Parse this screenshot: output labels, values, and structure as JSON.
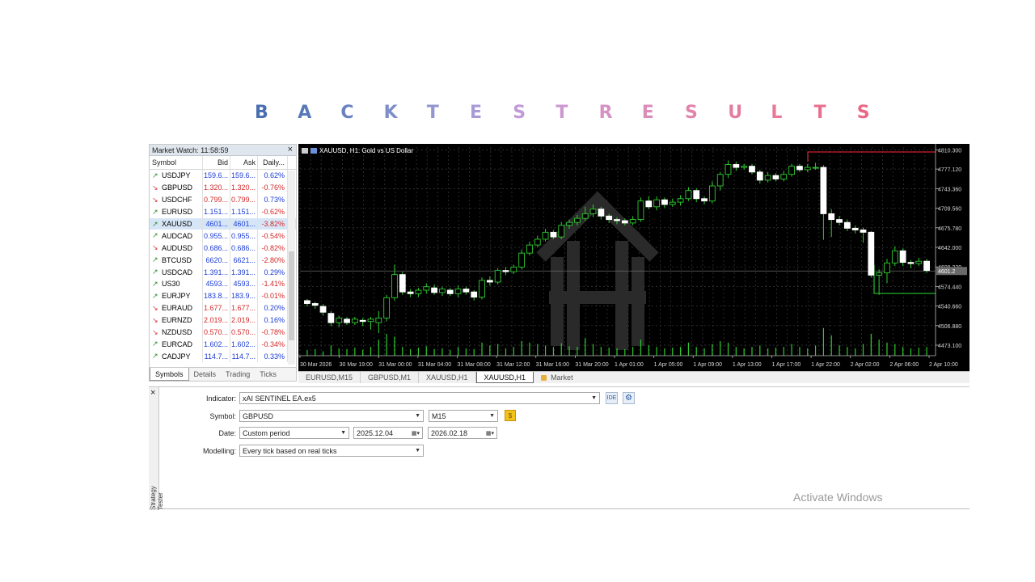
{
  "heading": {
    "letters": [
      "B",
      "A",
      "C",
      "K",
      "T",
      "E",
      "S",
      "T",
      "R",
      "E",
      "S",
      "U",
      "L",
      "T",
      "S"
    ],
    "colors": [
      "#4a6fb0",
      "#5878b8",
      "#6a82c0",
      "#7e8ec8",
      "#9496d2",
      "#a99cd6",
      "#c29ad8",
      "#cc98d0",
      "#d592c4",
      "#dc8cb8",
      "#e184ad",
      "#e47ca2",
      "#e77898",
      "#e8708e",
      "#e96884"
    ]
  },
  "market_watch": {
    "title": "Market Watch: 11:58:59",
    "close_icon": "×",
    "columns": [
      "Symbol",
      "Bid",
      "Ask",
      "Daily..."
    ],
    "rows": [
      {
        "symbol": "USDJPY",
        "dir": "up",
        "bid": "159.6...",
        "ask": "159.6...",
        "daily": "0.62%",
        "price_color": "blue",
        "change_color": "blue"
      },
      {
        "symbol": "GBPUSD",
        "dir": "down",
        "bid": "1.320...",
        "ask": "1.320...",
        "daily": "-0.76%",
        "price_color": "red",
        "change_color": "red"
      },
      {
        "symbol": "USDCHF",
        "dir": "down",
        "bid": "0.799...",
        "ask": "0.799...",
        "daily": "0.73%",
        "price_color": "red",
        "change_color": "blue"
      },
      {
        "symbol": "EURUSD",
        "dir": "up",
        "bid": "1.151...",
        "ask": "1.151...",
        "daily": "-0.62%",
        "price_color": "blue",
        "change_color": "red"
      },
      {
        "symbol": "XAUUSD",
        "dir": "up",
        "bid": "4601...",
        "ask": "4601...",
        "daily": "-3.82%",
        "price_color": "blue",
        "change_color": "red",
        "selected": true
      },
      {
        "symbol": "AUDCAD",
        "dir": "up",
        "bid": "0.955...",
        "ask": "0.955...",
        "daily": "-0.54%",
        "price_color": "blue",
        "change_color": "red"
      },
      {
        "symbol": "AUDUSD",
        "dir": "down",
        "bid": "0.686...",
        "ask": "0.686...",
        "daily": "-0.82%",
        "price_color": "blue",
        "change_color": "red"
      },
      {
        "symbol": "BTCUSD",
        "dir": "up",
        "bid": "6620...",
        "ask": "6621...",
        "daily": "-2.80%",
        "price_color": "blue",
        "change_color": "red"
      },
      {
        "symbol": "USDCAD",
        "dir": "up",
        "bid": "1.391...",
        "ask": "1.391...",
        "daily": "0.29%",
        "price_color": "blue",
        "change_color": "blue"
      },
      {
        "symbol": "US30",
        "dir": "up",
        "bid": "4593...",
        "ask": "4593...",
        "daily": "-1.41%",
        "price_color": "blue",
        "change_color": "red"
      },
      {
        "symbol": "EURJPY",
        "dir": "up",
        "bid": "183.8...",
        "ask": "183.9...",
        "daily": "-0.01%",
        "price_color": "blue",
        "change_color": "red"
      },
      {
        "symbol": "EURAUD",
        "dir": "down",
        "bid": "1.677...",
        "ask": "1.677...",
        "daily": "0.20%",
        "price_color": "red",
        "change_color": "blue"
      },
      {
        "symbol": "EURNZD",
        "dir": "down",
        "bid": "2.019...",
        "ask": "2.019...",
        "daily": "0.16%",
        "price_color": "red",
        "change_color": "blue"
      },
      {
        "symbol": "NZDUSD",
        "dir": "down",
        "bid": "0.570...",
        "ask": "0.570...",
        "daily": "-0.78%",
        "price_color": "red",
        "change_color": "red"
      },
      {
        "symbol": "EURCAD",
        "dir": "up",
        "bid": "1.602...",
        "ask": "1.602...",
        "daily": "-0.34%",
        "price_color": "blue",
        "change_color": "red"
      },
      {
        "symbol": "CADJPY",
        "dir": "up",
        "bid": "114.7...",
        "ask": "114.7...",
        "daily": "0.33%",
        "price_color": "blue",
        "change_color": "blue"
      }
    ],
    "tabs": [
      "Symbols",
      "Details",
      "Trading",
      "Ticks"
    ]
  },
  "chart": {
    "title": "XAUUSD, H1:  Gold vs US Dollar",
    "tabs": [
      "EURUSD,M15",
      "GBPUSD,M1",
      "XAUUSD,H1",
      "XAUUSD,H1",
      "Market"
    ],
    "active_tab": 3
  },
  "chart_data": {
    "type": "candlestick",
    "title": "XAUUSD, H1:  Gold vs US Dollar",
    "y_ticks": [
      "4810.300",
      "4777.120",
      "4743.360",
      "4709.560",
      "4675.780",
      "4642.000",
      "4608.220",
      "4574.440",
      "4540.660",
      "4506.880",
      "4473.100"
    ],
    "ylim": [
      4455,
      4815
    ],
    "current_price": "4601.2",
    "x_ticks": [
      "30 Mar 2026",
      "30 Mar 19:00",
      "31 Mar 00:00",
      "31 Mar 04:00",
      "31 Mar 08:00",
      "31 Mar 12:00",
      "31 Mar 16:00",
      "31 Mar 20:00",
      "1 Apr 01:00",
      "1 Apr 05:00",
      "1 Apr 09:00",
      "1 Apr 13:00",
      "1 Apr 17:00",
      "1 Apr 22:00",
      "2 Apr 02:00",
      "2 Apr 06:00",
      "2 Apr 10:00"
    ],
    "grid": true,
    "candles": [
      {
        "o": 4550,
        "c": 4545,
        "h": 4553,
        "l": 4540
      },
      {
        "o": 4545,
        "c": 4542,
        "h": 4548,
        "l": 4536
      },
      {
        "o": 4540,
        "c": 4530,
        "h": 4544,
        "l": 4524
      },
      {
        "o": 4528,
        "c": 4512,
        "h": 4532,
        "l": 4506
      },
      {
        "o": 4512,
        "c": 4520,
        "h": 4524,
        "l": 4504
      },
      {
        "o": 4518,
        "c": 4512,
        "h": 4522,
        "l": 4508
      },
      {
        "o": 4512,
        "c": 4518,
        "h": 4522,
        "l": 4508
      },
      {
        "o": 4516,
        "c": 4514,
        "h": 4520,
        "l": 4506
      },
      {
        "o": 4514,
        "c": 4518,
        "h": 4522,
        "l": 4500
      },
      {
        "o": 4512,
        "c": 4520,
        "h": 4532,
        "l": 4494
      },
      {
        "o": 4520,
        "c": 4555,
        "h": 4560,
        "l": 4514
      },
      {
        "o": 4555,
        "c": 4595,
        "h": 4612,
        "l": 4550
      },
      {
        "o": 4595,
        "c": 4565,
        "h": 4600,
        "l": 4560
      },
      {
        "o": 4565,
        "c": 4562,
        "h": 4570,
        "l": 4556
      },
      {
        "o": 4562,
        "c": 4568,
        "h": 4572,
        "l": 4556
      },
      {
        "o": 4568,
        "c": 4574,
        "h": 4580,
        "l": 4562
      },
      {
        "o": 4572,
        "c": 4564,
        "h": 4578,
        "l": 4560
      },
      {
        "o": 4564,
        "c": 4570,
        "h": 4574,
        "l": 4558
      },
      {
        "o": 4568,
        "c": 4562,
        "h": 4572,
        "l": 4558
      },
      {
        "o": 4562,
        "c": 4570,
        "h": 4576,
        "l": 4556
      },
      {
        "o": 4570,
        "c": 4565,
        "h": 4574,
        "l": 4560
      },
      {
        "o": 4565,
        "c": 4556,
        "h": 4568,
        "l": 4550
      },
      {
        "o": 4556,
        "c": 4585,
        "h": 4590,
        "l": 4552
      },
      {
        "o": 4585,
        "c": 4582,
        "h": 4592,
        "l": 4576
      },
      {
        "o": 4582,
        "c": 4602,
        "h": 4606,
        "l": 4578
      },
      {
        "o": 4602,
        "c": 4600,
        "h": 4608,
        "l": 4594
      },
      {
        "o": 4600,
        "c": 4608,
        "h": 4612,
        "l": 4596
      },
      {
        "o": 4608,
        "c": 4632,
        "h": 4638,
        "l": 4604
      },
      {
        "o": 4632,
        "c": 4646,
        "h": 4652,
        "l": 4628
      },
      {
        "o": 4646,
        "c": 4656,
        "h": 4662,
        "l": 4642
      },
      {
        "o": 4656,
        "c": 4668,
        "h": 4674,
        "l": 4652
      },
      {
        "o": 4668,
        "c": 4660,
        "h": 4672,
        "l": 4656
      },
      {
        "o": 4660,
        "c": 4680,
        "h": 4686,
        "l": 4656
      },
      {
        "o": 4680,
        "c": 4685,
        "h": 4690,
        "l": 4674
      },
      {
        "o": 4685,
        "c": 4692,
        "h": 4698,
        "l": 4680
      },
      {
        "o": 4692,
        "c": 4700,
        "h": 4712,
        "l": 4688
      },
      {
        "o": 4700,
        "c": 4708,
        "h": 4716,
        "l": 4694
      },
      {
        "o": 4708,
        "c": 4696,
        "h": 4712,
        "l": 4690
      },
      {
        "o": 4696,
        "c": 4690,
        "h": 4700,
        "l": 4684
      },
      {
        "o": 4690,
        "c": 4688,
        "h": 4694,
        "l": 4682
      },
      {
        "o": 4688,
        "c": 4684,
        "h": 4692,
        "l": 4680
      },
      {
        "o": 4684,
        "c": 4690,
        "h": 4696,
        "l": 4680
      },
      {
        "o": 4690,
        "c": 4722,
        "h": 4728,
        "l": 4686
      },
      {
        "o": 4722,
        "c": 4712,
        "h": 4730,
        "l": 4708
      },
      {
        "o": 4712,
        "c": 4724,
        "h": 4730,
        "l": 4706
      },
      {
        "o": 4724,
        "c": 4716,
        "h": 4728,
        "l": 4710
      },
      {
        "o": 4716,
        "c": 4720,
        "h": 4726,
        "l": 4712
      },
      {
        "o": 4720,
        "c": 4726,
        "h": 4732,
        "l": 4714
      },
      {
        "o": 4726,
        "c": 4740,
        "h": 4746,
        "l": 4722
      },
      {
        "o": 4740,
        "c": 4726,
        "h": 4744,
        "l": 4720
      },
      {
        "o": 4726,
        "c": 4722,
        "h": 4730,
        "l": 4716
      },
      {
        "o": 4722,
        "c": 4748,
        "h": 4756,
        "l": 4718
      },
      {
        "o": 4748,
        "c": 4768,
        "h": 4772,
        "l": 4740
      },
      {
        "o": 4768,
        "c": 4785,
        "h": 4792,
        "l": 4762
      },
      {
        "o": 4785,
        "c": 4780,
        "h": 4790,
        "l": 4774
      },
      {
        "o": 4780,
        "c": 4782,
        "h": 4786,
        "l": 4776
      },
      {
        "o": 4782,
        "c": 4772,
        "h": 4786,
        "l": 4768
      },
      {
        "o": 4772,
        "c": 4758,
        "h": 4776,
        "l": 4752
      },
      {
        "o": 4758,
        "c": 4766,
        "h": 4772,
        "l": 4754
      },
      {
        "o": 4766,
        "c": 4760,
        "h": 4770,
        "l": 4756
      },
      {
        "o": 4760,
        "c": 4768,
        "h": 4774,
        "l": 4756
      },
      {
        "o": 4768,
        "c": 4782,
        "h": 4786,
        "l": 4764
      },
      {
        "o": 4782,
        "c": 4776,
        "h": 4786,
        "l": 4772
      },
      {
        "o": 4776,
        "c": 4780,
        "h": 4786,
        "l": 4772
      },
      {
        "o": 4780,
        "c": 4780,
        "h": 4788,
        "l": 4776
      },
      {
        "o": 4780,
        "c": 4700,
        "h": 4784,
        "l": 4655
      },
      {
        "o": 4700,
        "c": 4690,
        "h": 4708,
        "l": 4660
      },
      {
        "o": 4690,
        "c": 4685,
        "h": 4696,
        "l": 4680
      },
      {
        "o": 4685,
        "c": 4675,
        "h": 4690,
        "l": 4670
      },
      {
        "o": 4675,
        "c": 4672,
        "h": 4680,
        "l": 4666
      },
      {
        "o": 4672,
        "c": 4668,
        "h": 4676,
        "l": 4650
      },
      {
        "o": 4668,
        "c": 4594,
        "h": 4670,
        "l": 4590
      },
      {
        "o": 4594,
        "c": 4598,
        "h": 4604,
        "l": 4560
      },
      {
        "o": 4598,
        "c": 4615,
        "h": 4622,
        "l": 4580
      },
      {
        "o": 4615,
        "c": 4636,
        "h": 4644,
        "l": 4610
      },
      {
        "o": 4636,
        "c": 4616,
        "h": 4640,
        "l": 4610
      },
      {
        "o": 4616,
        "c": 4614,
        "h": 4620,
        "l": 4606
      },
      {
        "o": 4614,
        "c": 4618,
        "h": 4624,
        "l": 4610
      },
      {
        "o": 4618,
        "c": 4602,
        "h": 4622,
        "l": 4598
      }
    ],
    "volumes": [
      8,
      9,
      6,
      14,
      10,
      9,
      11,
      8,
      12,
      22,
      30,
      26,
      12,
      9,
      11,
      13,
      9,
      10,
      8,
      12,
      10,
      9,
      18,
      14,
      16,
      10,
      12,
      20,
      18,
      16,
      14,
      12,
      17,
      13,
      12,
      24,
      16,
      12,
      11,
      10,
      9,
      12,
      22,
      14,
      12,
      10,
      11,
      12,
      18,
      12,
      10,
      16,
      20,
      18,
      12,
      10,
      12,
      14,
      10,
      11,
      12,
      16,
      12,
      10,
      14,
      38,
      28,
      14,
      12,
      10,
      16,
      30,
      22,
      18,
      16,
      12,
      10,
      11,
      12
    ]
  },
  "tester": {
    "close_icon": "×",
    "vertical_label": "Strategy Tester",
    "indicator_label": "Indicator:",
    "indicator_value": "xAI SENTINEL EA.ex5",
    "ide_btn": "IDE",
    "settings_icon": "⚙",
    "symbol_label": "Symbol:",
    "symbol_value": "GBPUSD",
    "timeframe_value": "M15",
    "gold_btn": "$",
    "date_label": "Date:",
    "date_mode": "Custom period",
    "date_from": "2025.12.04",
    "date_to": "2026.02.18",
    "modelling_label": "Modelling:",
    "modelling_value": "Every tick based on real ticks"
  },
  "watermark": {
    "line1": "Activate Windows"
  }
}
